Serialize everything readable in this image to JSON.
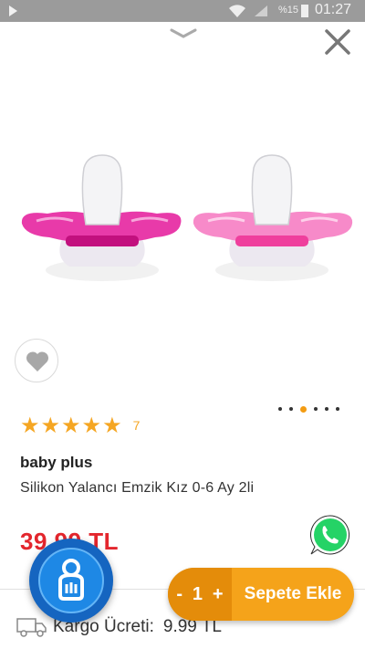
{
  "status_bar": {
    "time": "01:27",
    "battery_percent": "%15"
  },
  "product": {
    "brand": "baby plus",
    "name": "Silikon Yalancı Emzik Kız 0-6 Ay 2li",
    "price": "39,99 TL",
    "rating_count": "7",
    "rating_stars": 5
  },
  "carousel": {
    "total": 6,
    "active_index": 2
  },
  "cart": {
    "minus": "-",
    "quantity": "1",
    "plus": "+",
    "add_label": "Sepete Ekle"
  },
  "shipping": {
    "label": "Kargo Ücreti:",
    "value": "9.99 TL"
  },
  "colors": {
    "accent": "#f5a31a",
    "price": "#e3262d",
    "star": "#f5a623",
    "whatsapp": "#25d366",
    "fab": "#1e88e5"
  },
  "icons": [
    "play-icon",
    "wifi-icon",
    "signal-icon",
    "battery-icon",
    "chevron-down-icon",
    "close-icon",
    "heart-icon",
    "star-icon",
    "whatsapp-icon",
    "truck-icon",
    "chat-icon"
  ]
}
